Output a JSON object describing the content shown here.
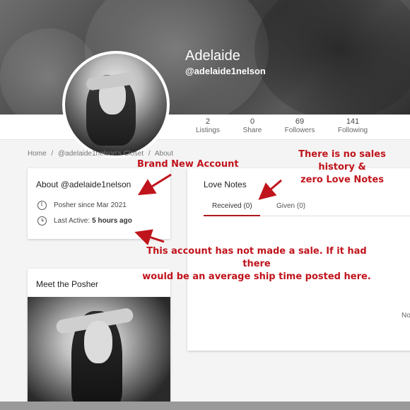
{
  "profile": {
    "name": "Adelaide",
    "handle": "@adelaide1nelson"
  },
  "stats": [
    {
      "value": "2",
      "label": "Listings"
    },
    {
      "value": "0",
      "label": "Share"
    },
    {
      "value": "69",
      "label": "Followers"
    },
    {
      "value": "141",
      "label": "Following"
    }
  ],
  "breadcrumb": [
    "Home",
    "/",
    "@adelaide1nelson's Closet",
    "/",
    "About"
  ],
  "about": {
    "title": "About @adelaide1nelson",
    "since": "Posher since Mar 2021",
    "last_active_label": "Last Active:",
    "last_active_value": "5 hours ago"
  },
  "meet": {
    "title": "Meet the Posher"
  },
  "love_notes": {
    "title": "Love Notes",
    "tabs": [
      "Received (0)",
      "Given (0)"
    ],
    "empty_text": "No"
  },
  "annotations": {
    "brand_new": "Brand New Account",
    "no_sales_line1": "There is no sales history &",
    "no_sales_line2": "zero Love Notes",
    "no_sale_line1": "This account has not made a sale.  If it had there",
    "no_sale_line2": "would be an average ship time posted here."
  },
  "colors": {
    "accent": "#b0181e",
    "annotation": "#c0141c"
  }
}
